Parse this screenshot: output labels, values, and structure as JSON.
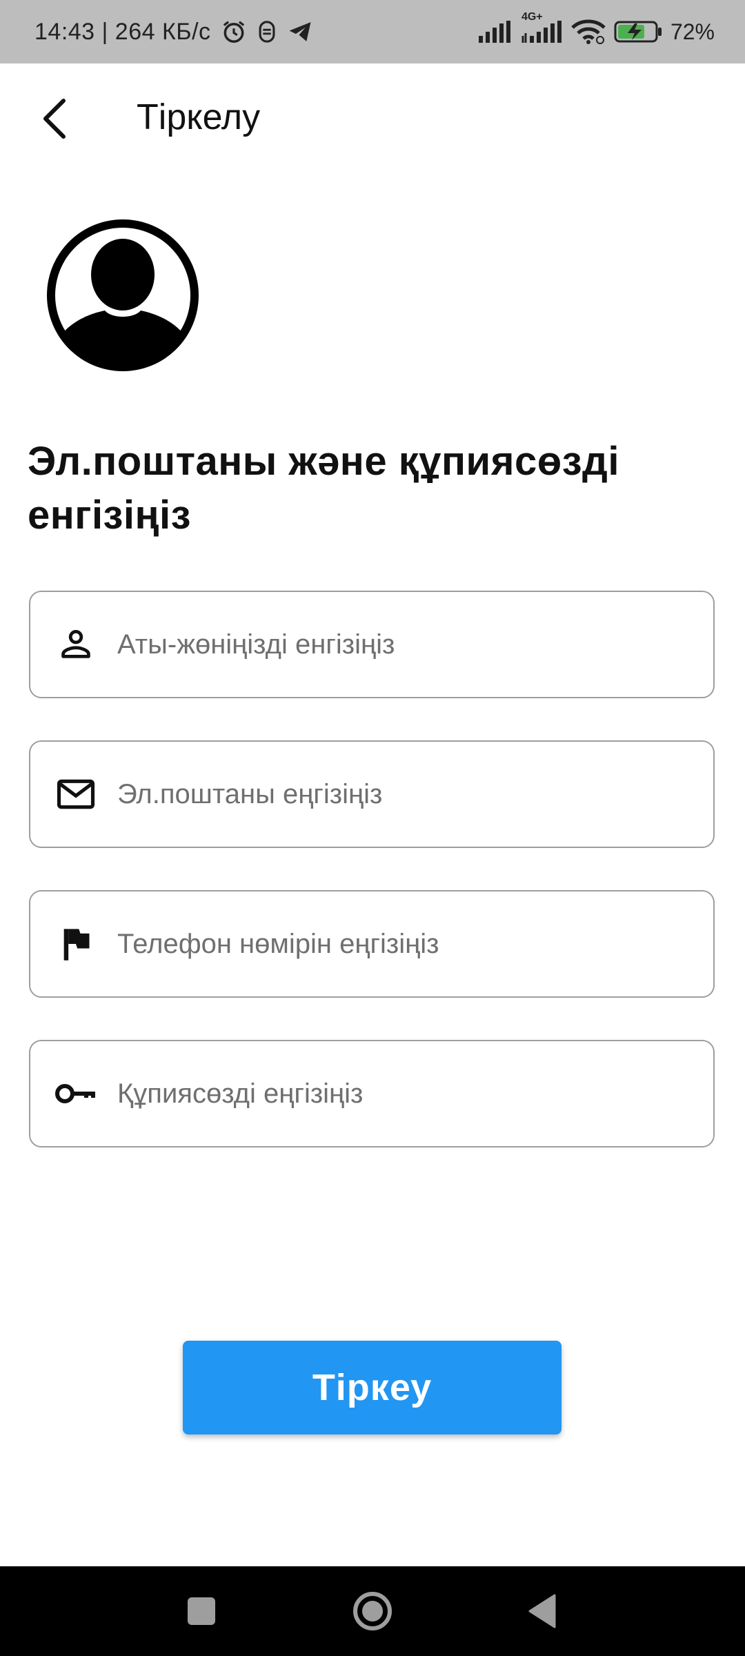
{
  "status_bar": {
    "time_speed": "14:43 | 264 КБ/с",
    "network_label": "4G+",
    "battery_percent": "72%"
  },
  "app_bar": {
    "title": "Тіркелу"
  },
  "form": {
    "heading": "Эл.поштаны және құпиясөзді енгізіңіз",
    "fields": [
      {
        "icon": "person-icon",
        "placeholder": "Аты-жөніңізді енгізіңіз",
        "value": ""
      },
      {
        "icon": "mail-icon",
        "placeholder": "Эл.поштаны еңгізіңіз",
        "value": ""
      },
      {
        "icon": "flag-icon",
        "placeholder": "Телефон нөмірін еңгізіңіз",
        "value": ""
      },
      {
        "icon": "key-icon",
        "placeholder": "Құпиясөзді еңгізіңіз",
        "value": ""
      }
    ],
    "submit_label": "Тіркеу"
  },
  "colors": {
    "accent": "#2196f3",
    "status_bar_bg": "#bdbdbd",
    "nav_bar_bg": "#000000",
    "field_border": "#9e9e9e",
    "battery_fill": "#4caf50"
  }
}
